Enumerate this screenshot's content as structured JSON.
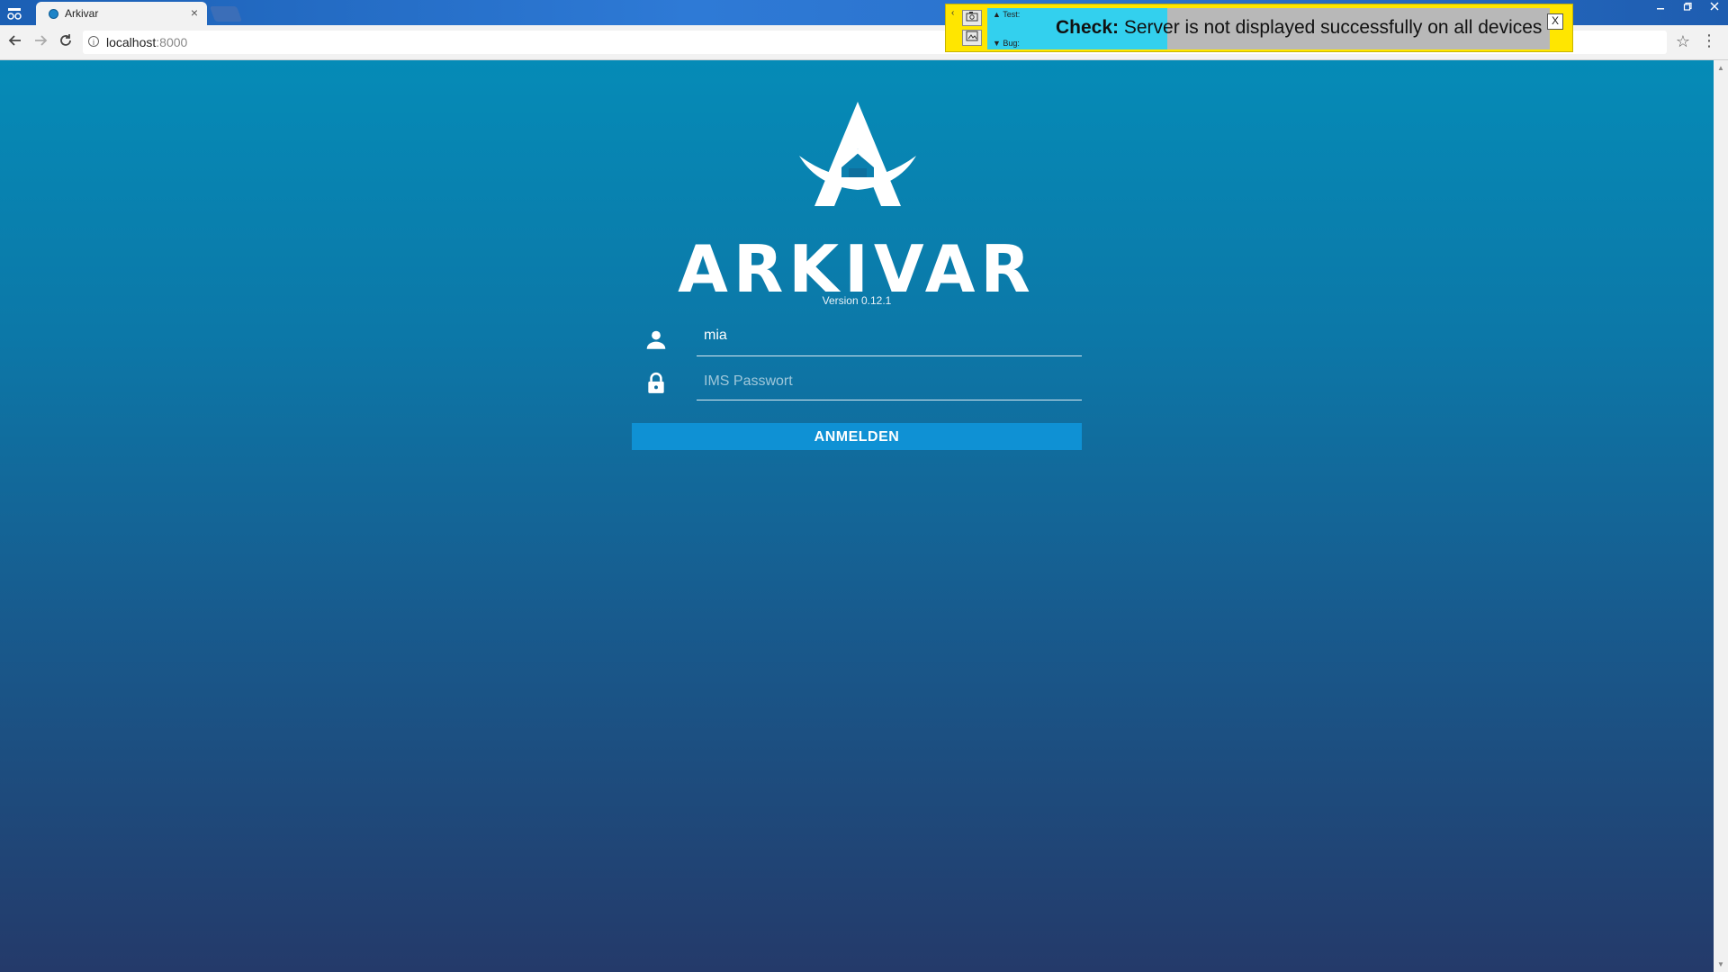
{
  "browser": {
    "tab_title": "Arkivar",
    "tab_close": "×",
    "url_host": "localhost",
    "url_port": ":8000"
  },
  "checker": {
    "test_label": "▲ Test:",
    "bug_label": "▼ Bug:",
    "check_label": "Check:",
    "check_text": "Server is not displayed successfully on all devices",
    "close_label": "X"
  },
  "app": {
    "name": "ARKIVAR",
    "version": "Version 0.12.1",
    "username_value": "mia",
    "password_placeholder": "IMS Passwort",
    "login_label": "ANMELDEN"
  },
  "colors": {
    "background_top": "#058bb7",
    "background_bottom": "#243a6a",
    "button": "#0f91d4",
    "checker_bar": "#ffe600"
  }
}
